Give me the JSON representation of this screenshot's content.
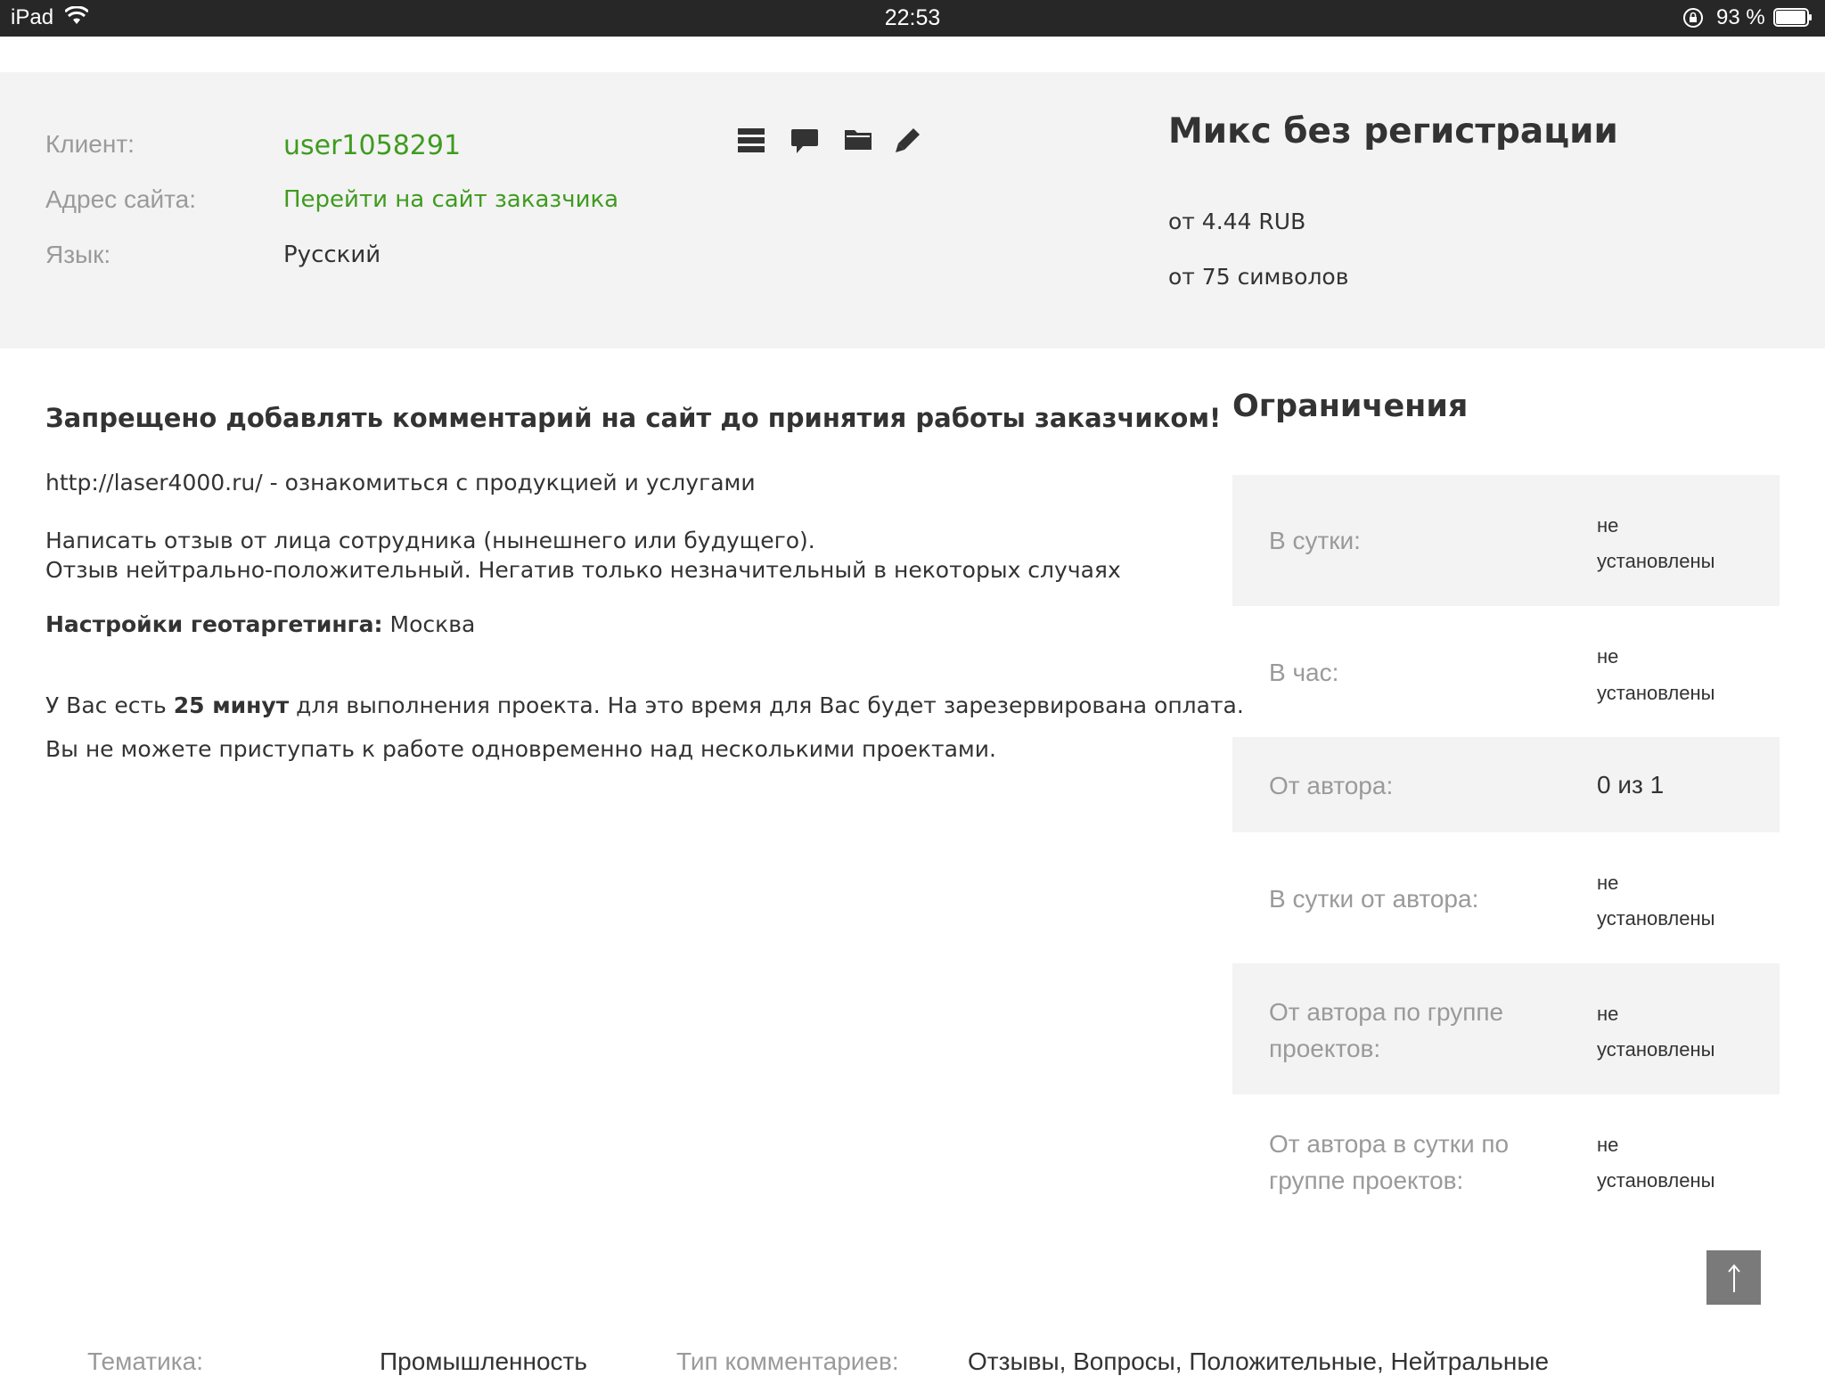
{
  "status_bar": {
    "device": "iPad",
    "time": "22:53",
    "battery": "93 %"
  },
  "header": {
    "client_label": "Клиент:",
    "client_value": "user1058291",
    "site_label": "Адрес сайта:",
    "site_value": "Перейти на сайт заказчика",
    "lang_label": "Язык:",
    "lang_value": "Русский",
    "icons": [
      "list-icon",
      "comment-icon",
      "folder-icon",
      "pencil-icon"
    ],
    "plan_title": "Микс без регистрации",
    "price": "от 4.44 RUB",
    "min_chars": "от 75 символов"
  },
  "description": {
    "warning": "Запрещено добавлять комментарий на сайт до принятия работы заказчиком!",
    "link_line": "http://laser4000.ru/ - ознакомиться с продукцией и услугами",
    "line1": "Написать отзыв от лица сотрудника (нынешнего или будущего).",
    "line2": "Отзыв нейтрально-положительный. Негатив только незначительный в некоторых случаях",
    "geo_label": "Настройки геотаргетинга:",
    "geo_value": " Москва",
    "time_prefix": "У Вас есть ",
    "time_value": "25 минут",
    "time_suffix": " для выполнения проекта. На это время для Вас будет зарезервирована оплата.",
    "multi_project": "Вы не можете приступать к работе одновременно над несколькими проектами."
  },
  "restrictions": {
    "title": "Ограничения",
    "rows": [
      {
        "label_1": "В сутки:",
        "label_2": "",
        "value_1": "не",
        "value_2": "установлены"
      },
      {
        "label_1": "В час:",
        "label_2": "",
        "value_1": "не",
        "value_2": "установлены"
      },
      {
        "label_1": "От автора:",
        "label_2": "",
        "value_1": "0 из 1",
        "value_2": ""
      },
      {
        "label_1": "В сутки от автора:",
        "label_2": "",
        "value_1": "не",
        "value_2": "установлены"
      },
      {
        "label_1": "От автора по группе",
        "label_2": "проектов:",
        "value_1": "не",
        "value_2": "установлены"
      },
      {
        "label_1": "От автора в сутки по",
        "label_2": "группе проектов:",
        "value_1": "не",
        "value_2": "установлены"
      }
    ]
  },
  "footer": {
    "topic_label": "Тематика:",
    "topic_value": "Промышленность",
    "type_label": "Тип комментариев:",
    "type_value": "Отзывы, Вопросы, Положительные, Нейтральные"
  },
  "to_top_button": "↑"
}
